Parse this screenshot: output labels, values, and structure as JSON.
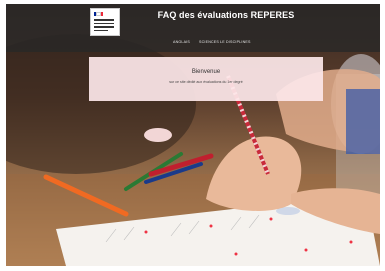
{
  "header": {
    "site_title": "FAQ des évaluations REPERES",
    "nav": [
      "ANGLAIS",
      "SCIENCES",
      "LE DISCIPLINES"
    ]
  },
  "welcome": {
    "title": "Bienvenue",
    "subtitle": "sur ce site dédié aux évaluations du 1er degré"
  },
  "colors": {
    "header_bg": "#282828",
    "card_bg": "#fce6e8",
    "flag_blue": "#002395",
    "flag_white": "#ffffff",
    "flag_red": "#ed2939"
  }
}
